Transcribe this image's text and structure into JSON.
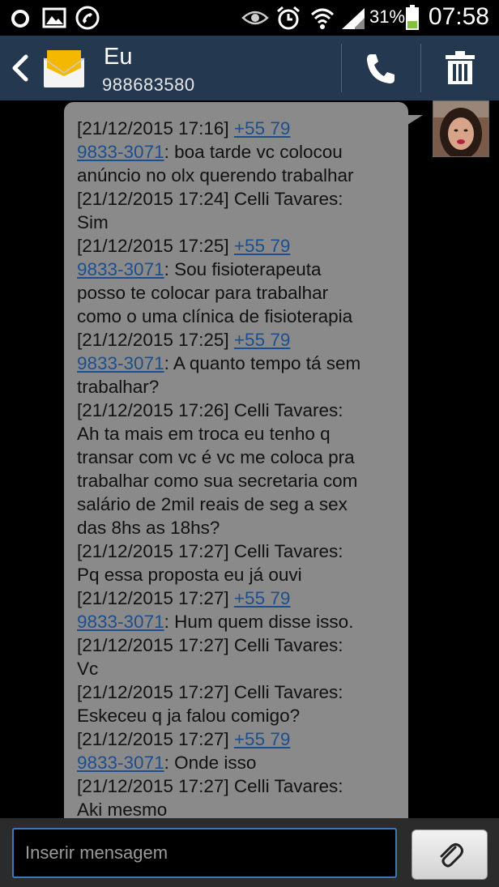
{
  "status_bar": {
    "battery": "31%",
    "time": "07:58"
  },
  "contact": {
    "name": "Eu",
    "number": "988683580"
  },
  "input": {
    "placeholder": "Inserir mensagem"
  },
  "message": {
    "lines": [
      [
        {
          "t": "[21/12/2015 17:16] "
        },
        {
          "t": "+55 79",
          "link": true
        }
      ],
      [
        {
          "t": "9833-3071",
          "link": true
        },
        {
          "t": ": boa tarde vc colocou"
        }
      ],
      [
        {
          "t": "anúncio no olx querendo trabalhar"
        }
      ],
      [
        {
          "t": "[21/12/2015 17:24] Celli Tavares:"
        }
      ],
      [
        {
          "t": "Sim"
        }
      ],
      [
        {
          "t": "[21/12/2015 17:25] "
        },
        {
          "t": "+55 79",
          "link": true
        }
      ],
      [
        {
          "t": "9833-3071",
          "link": true
        },
        {
          "t": ": Sou fisioterapeuta"
        }
      ],
      [
        {
          "t": "posso te colocar para trabalhar"
        }
      ],
      [
        {
          "t": "como o uma clínica de fisioterapia"
        }
      ],
      [
        {
          "t": "[21/12/2015 17:25] "
        },
        {
          "t": "+55 79",
          "link": true
        }
      ],
      [
        {
          "t": "9833-3071",
          "link": true
        },
        {
          "t": ": A quanto tempo tá sem"
        }
      ],
      [
        {
          "t": "trabalhar?"
        }
      ],
      [
        {
          "t": "[21/12/2015 17:26] Celli Tavares:"
        }
      ],
      [
        {
          "t": "Ah ta mais em troca eu tenho q"
        }
      ],
      [
        {
          "t": "transar com vc é vc me coloca pra"
        }
      ],
      [
        {
          "t": "trabalhar como sua secretaria com"
        }
      ],
      [
        {
          "t": "salário de 2mil reais de seg a sex"
        }
      ],
      [
        {
          "t": "das 8hs as 18hs?"
        }
      ],
      [
        {
          "t": "[21/12/2015 17:27] Celli Tavares:"
        }
      ],
      [
        {
          "t": "Pq essa proposta eu já ouvi"
        }
      ],
      [
        {
          "t": "[21/12/2015 17:27] "
        },
        {
          "t": "+55 79",
          "link": true
        }
      ],
      [
        {
          "t": "9833-3071",
          "link": true
        },
        {
          "t": ": Hum quem disse isso."
        }
      ],
      [
        {
          "t": "[21/12/2015 17:27] Celli Tavares:"
        }
      ],
      [
        {
          "t": "Vc"
        }
      ],
      [
        {
          "t": "[21/12/2015 17:27] Celli Tavares:"
        }
      ],
      [
        {
          "t": "Eskeceu q ja falou comigo?"
        }
      ],
      [
        {
          "t": "[21/12/2015 17:27] "
        },
        {
          "t": "+55 79",
          "link": true
        }
      ],
      [
        {
          "t": "9833-3071",
          "link": true
        },
        {
          "t": ": Onde isso"
        }
      ],
      [
        {
          "t": "[21/12/2015 17:27] Celli Tavares:"
        }
      ],
      [
        {
          "t": "Aki mesmo"
        }
      ]
    ]
  },
  "icons": {
    "status_left": [
      "circle-notification-icon",
      "image-notification-icon",
      "missed-call-icon"
    ],
    "status_right": [
      "eye-icon",
      "alarm-icon",
      "wifi-icon",
      "signal-icon",
      "battery-icon"
    ],
    "header": [
      "back-arrow-icon",
      "envelope-icon",
      "phone-icon",
      "trash-icon"
    ],
    "input": [
      "paperclip-icon"
    ]
  },
  "colors": {
    "header_bg": "#24384f",
    "bubble_bg": "#8a8a8a",
    "link": "#1c4f8f",
    "input_border": "#3c78b4"
  }
}
